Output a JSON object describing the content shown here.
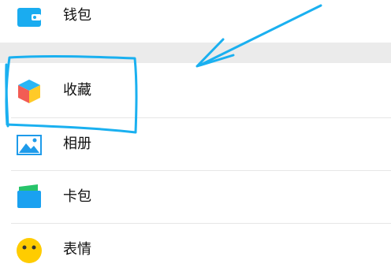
{
  "menu": {
    "items": [
      {
        "label": "钱包",
        "icon": "wallet-icon",
        "color": "#1AACF0"
      },
      {
        "label": "收藏",
        "icon": "favorites-cube-icon",
        "colors": [
          "#F25C54",
          "#29B6F6",
          "#FFCA28"
        ]
      },
      {
        "label": "相册",
        "icon": "album-icon",
        "color": "#1E9BEA"
      },
      {
        "label": "卡包",
        "icon": "card-wallet-icon",
        "color": "#27C46A"
      },
      {
        "label": "表情",
        "icon": "emoji-icon",
        "color": "#FFCC00"
      }
    ]
  },
  "annotation": {
    "color": "#1AB0F0"
  }
}
